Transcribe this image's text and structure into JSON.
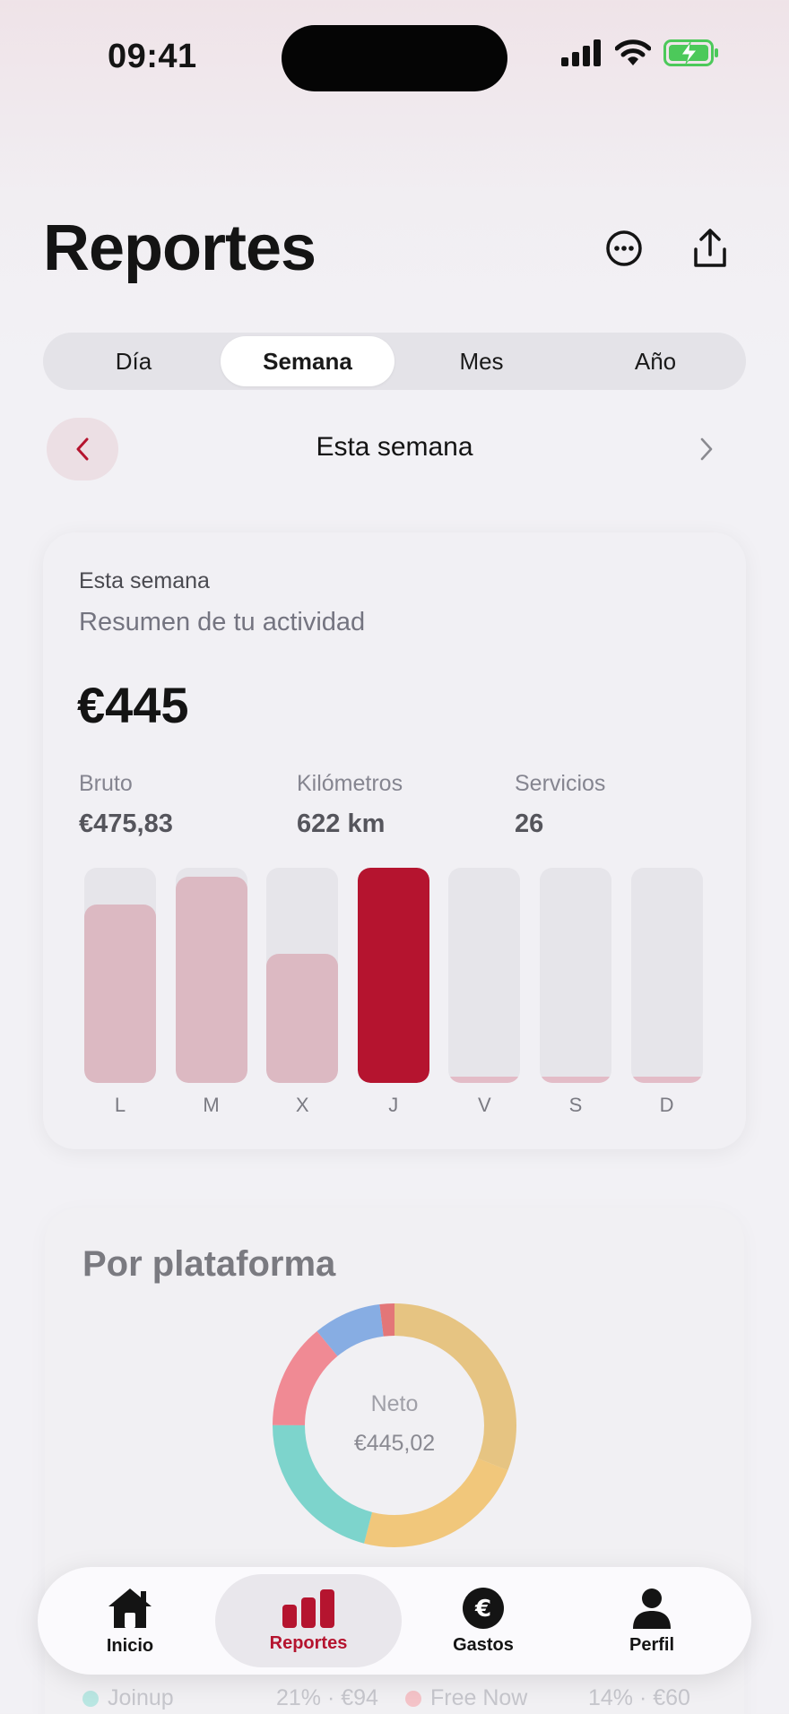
{
  "status_bar": {
    "time": "09:41"
  },
  "header": {
    "title": "Reportes",
    "more_icon": "ellipsis-circle-icon",
    "share_icon": "share-icon"
  },
  "segments": [
    {
      "label": "Día",
      "active": false
    },
    {
      "label": "Semana",
      "active": true
    },
    {
      "label": "Mes",
      "active": false
    },
    {
      "label": "Año",
      "active": false
    }
  ],
  "week_nav": {
    "title": "Esta semana"
  },
  "summary": {
    "kicker": "Esta semana",
    "subtitle": "Resumen de tu actividad",
    "amount": "€445",
    "metrics": [
      {
        "label": "Bruto",
        "value": "€475,83"
      },
      {
        "label": "Kilómetros",
        "value": "622 km"
      },
      {
        "label": "Servicios",
        "value": "26"
      }
    ]
  },
  "chart_data": {
    "type": "bar",
    "categories": [
      "L",
      "M",
      "X",
      "J",
      "V",
      "S",
      "D"
    ],
    "values": [
      0.83,
      0.96,
      0.6,
      1.0,
      0.03,
      0.03,
      0.03
    ],
    "highlight_index": 3,
    "colors": {
      "bar": "#dcb9c2",
      "highlight": "#b5142f",
      "empty": "#e6e5ea",
      "stub": "#e3bcc7"
    }
  },
  "platform": {
    "title": "Por plataforma",
    "center_label": "Neto",
    "center_value": "€445,02",
    "donut": [
      {
        "fraction": 0.31,
        "color": "#e4bd72"
      },
      {
        "fraction": 0.23,
        "color": "#f0c06a"
      },
      {
        "fraction": 0.21,
        "color": "#6ccfc6"
      },
      {
        "fraction": 0.14,
        "color": "#ef7b86"
      },
      {
        "fraction": 0.09,
        "color": "#78a3e0"
      },
      {
        "fraction": 0.02,
        "color": "#e06466"
      }
    ],
    "legend": [
      {
        "name": "Joinup",
        "value": "21% · €94",
        "color": "#6ccfc6"
      },
      {
        "name": "Free Now",
        "value": "14% · €60",
        "color": "#ef7b86"
      }
    ]
  },
  "tabbar": [
    {
      "label": "Inicio",
      "icon": "home-icon",
      "active": false
    },
    {
      "label": "Reportes",
      "icon": "bar-chart-icon",
      "active": true
    },
    {
      "label": "Gastos",
      "icon": "euro-icon",
      "active": false
    },
    {
      "label": "Perfil",
      "icon": "person-icon",
      "active": false
    }
  ]
}
